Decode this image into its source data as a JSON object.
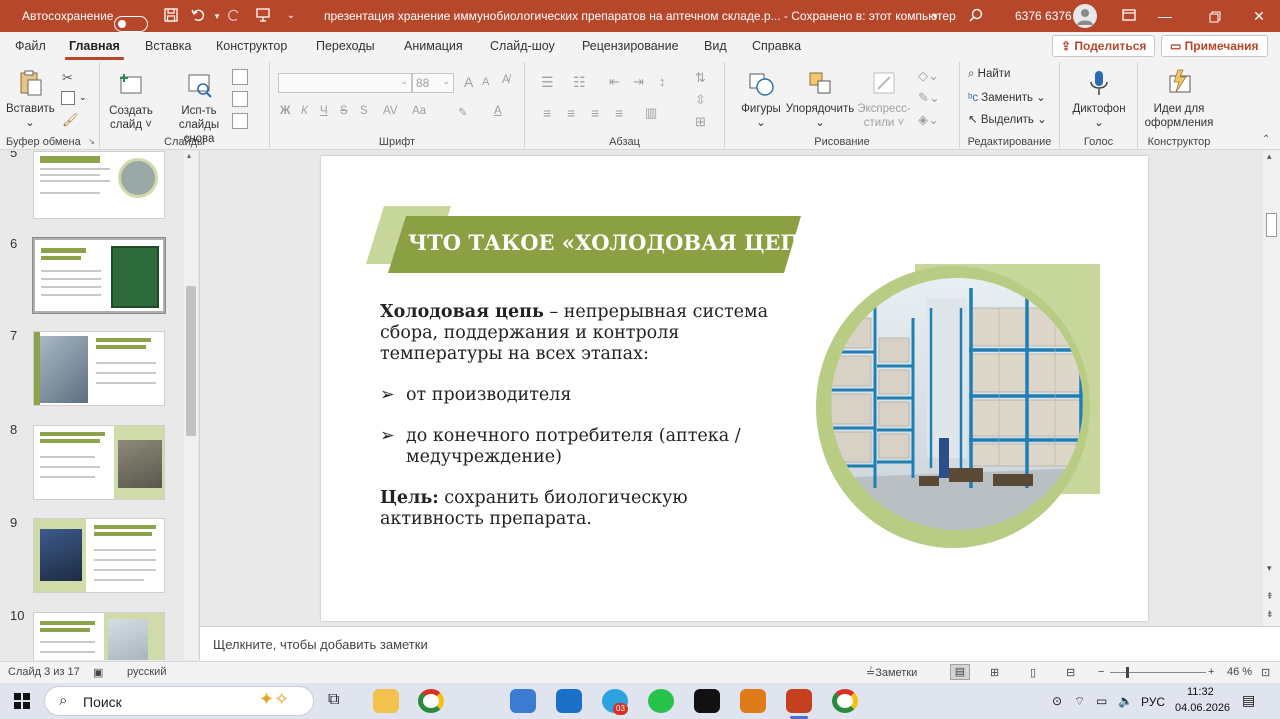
{
  "titlebar": {
    "autosave_label": "Автосохранение",
    "document_title": "презентация хранение иммунобиологических препаратов на аптечном складе.р...  -  Сохранено в: этот компьютер",
    "user_name": "6376 6376",
    "icons": [
      "save-icon",
      "undo-icon",
      "redo-icon",
      "present-icon",
      "customize-icon",
      "search-icon",
      "user-avatar-icon",
      "minimize-icon",
      "maximize-icon",
      "close-icon"
    ]
  },
  "menu": {
    "tabs": [
      "Файл",
      "Главная",
      "Вставка",
      "Конструктор",
      "Переходы",
      "Анимация",
      "Слайд-шоу",
      "Рецензирование",
      "Вид",
      "Справка"
    ],
    "active_tab": "Главная",
    "share_label": "Поделиться",
    "comments_label": "Примечания"
  },
  "ribbon": {
    "clipboard": {
      "label": "Буфер обмена",
      "paste": "Вставить"
    },
    "slides": {
      "label": "Слайды",
      "new_slide_1": "Создать",
      "new_slide_2": "слайд ˅",
      "reuse_1": "Исп-ть",
      "reuse_2": "слайды снова"
    },
    "font": {
      "label": "Шрифт",
      "size": "88",
      "bold": "Ж",
      "italic": "К",
      "underline": "Ч",
      "strike": "S",
      "spacing": "AV",
      "case": "Aa",
      "highlight": "A",
      "color": "A"
    },
    "paragraph": {
      "label": "Абзац"
    },
    "drawing": {
      "label": "Рисование",
      "shapes": "Фигуры",
      "arrange": "Упорядочить",
      "styles_1": "Экспресс-",
      "styles_2": "стили ˅"
    },
    "editing": {
      "label": "Редактирование",
      "find": "Найти",
      "replace": "Заменить",
      "select": "Выделить"
    },
    "voice": {
      "label": "Голос",
      "dictate": "Диктофон"
    },
    "designer": {
      "label": "Конструктор",
      "ideas_1": "Идеи для",
      "ideas_2": "оформления"
    }
  },
  "thumbnails": {
    "items": [
      {
        "number": "5",
        "title": "ТЕМПЕРАТУРНЫЕ УСЛОВИЯ ХРАНЕНИЯ"
      },
      {
        "number": "6",
        "title": "ДОКУМЕНТАЦИЯ ПРИ ПРИЕМЕ"
      },
      {
        "number": "7",
        "title": "НЕМЕДЛЕННОЕ РАЗМЕЩЕНИЕ ПОСЛЕ ПРИЕМА"
      },
      {
        "number": "8",
        "title": "ЭТАП 2: ХРАНЕНИЕ НА СКЛАДЕ – ТЕМПЕРАТУРНЫЙ РЕЖИМ"
      },
      {
        "number": "9",
        "title": "ТИПЫ ХОЛОДИЛЬНОГО ОБОРУДОВАНИЯ НА СКЛАДЕ"
      },
      {
        "number": "10",
        "title": "ОРГАНИЗАЦИЯ РАЗМЕЩЕНИЯ ВНУТРИ КАМЕРЫ"
      }
    ]
  },
  "slide": {
    "title": "ЧТО ТАКОЕ «ХОЛОДОВАЯ ЦЕПЬ»?",
    "def_term": "Холодовая цепь",
    "def_text_1": " – непрерывная система",
    "def_text_2": "сбора, поддержания и контроля",
    "def_text_3": "температуры на всех этапах:",
    "bullet_1": "от производителя",
    "bullet_2_line1": "до конечного потребителя (аптека /",
    "bullet_2_line2": "медучреждение)",
    "goal_term": "Цель:",
    "goal_text_1": " сохранить биологическую",
    "goal_text_2": "активность препарата.",
    "image": "warehouse-shelves-photo",
    "colors": {
      "accent_green": "#8ba043",
      "light_green": "#c7d69b",
      "ring_green": "#b9cc83"
    }
  },
  "notes": {
    "placeholder": "Щелкните, чтобы добавить заметки"
  },
  "status": {
    "slide_counter": "Слайд 3 из 17",
    "language": "русский",
    "notes_button": "Заметки",
    "zoom": "46 %"
  },
  "taskbar": {
    "search_label": "Поиск",
    "telegram_badge": "03",
    "lang": "РУС",
    "time": "11:32",
    "date": "04.06.2026",
    "apps": [
      "start-icon",
      "task-view-icon",
      "explorer-icon",
      "chrome-icon",
      "code-editor-icon",
      "outlook-icon",
      "telegram-icon",
      "whatsapp-icon",
      "notion-icon",
      "sublime-icon",
      "powerpoint-icon",
      "chrome-alt-icon"
    ]
  }
}
